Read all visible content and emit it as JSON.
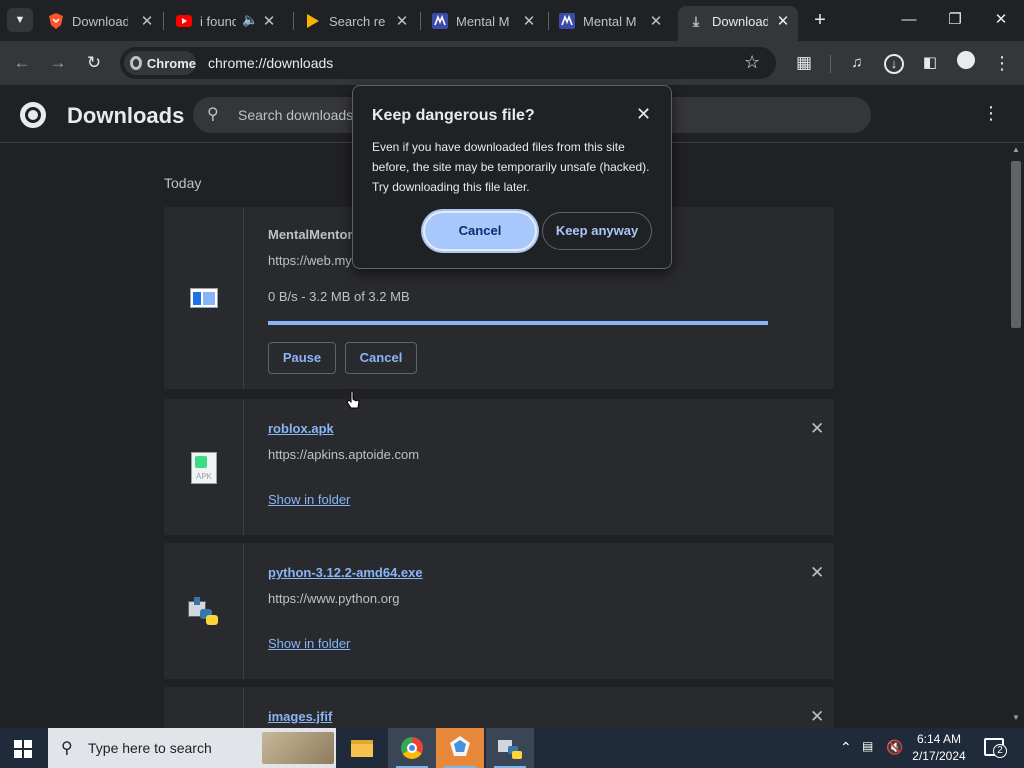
{
  "tabs": [
    {
      "title": "Download",
      "favicon": "brave-shield-icon",
      "color": "#fb542b"
    },
    {
      "title": "i found",
      "favicon": "youtube-icon",
      "color": "#ff0000"
    },
    {
      "title": "Search res",
      "favicon": "play-icon",
      "color": "#f4b400"
    },
    {
      "title": "Mental M",
      "favicon": "mental-mentor-icon",
      "color": "#6c7bd6"
    },
    {
      "title": "Mental M",
      "favicon": "mental-mentor-icon",
      "color": "#6c7bd6"
    },
    {
      "title": "Download",
      "favicon": "download-icon",
      "color": "#bdc1c6"
    }
  ],
  "toolbar": {
    "chip_label": "Chrome",
    "url": "chrome://downloads"
  },
  "header": {
    "title": "Downloads",
    "search_placeholder": "Search downloads"
  },
  "main": {
    "date_label": "Today",
    "items": [
      {
        "name": "MentalMentor",
        "source": "https://web.my",
        "progress_text": "0 B/s - 3.2 MB of 3.2 MB",
        "progress": 1.0,
        "pause_label": "Pause",
        "cancel_label": "Cancel"
      },
      {
        "name": "roblox.apk",
        "source": "https://apkins.aptoide.com",
        "action_label": "Show in folder",
        "icon_label": "APK"
      },
      {
        "name": "python-3.12.2-amd64.exe",
        "source": "https://www.python.org",
        "action_label": "Show in folder"
      },
      {
        "name": "images.jfif"
      }
    ]
  },
  "dialog": {
    "title": "Keep dangerous file?",
    "body": "Even if you have downloaded files from this site before, the site may be temporarily unsafe (hacked). Try downloading this file later.",
    "cancel_label": "Cancel",
    "keep_label": "Keep anyway"
  },
  "taskbar": {
    "search_placeholder": "Type here to search",
    "time": "6:14 AM",
    "date": "2/17/2024",
    "notification_count": "2"
  },
  "colors": {
    "accent": "#8ab4f8",
    "primary_button": "#a8c7fa",
    "background": "#202124"
  }
}
